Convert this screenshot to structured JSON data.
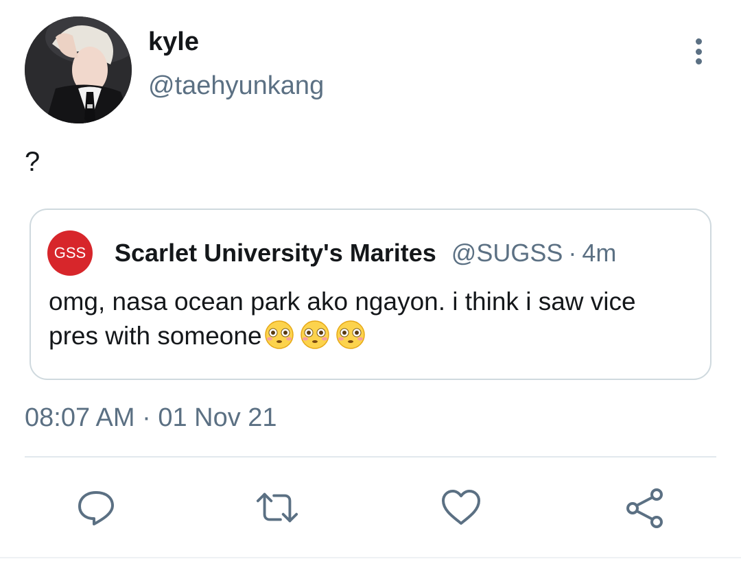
{
  "tweet": {
    "author": {
      "display_name": "kyle",
      "handle": "@taehyunkang"
    },
    "text": "?",
    "timestamp": "08:07 AM · 01 Nov 21",
    "quoted": {
      "avatar_text": "GSS",
      "display_name": "Scarlet University's Marites",
      "handle": "@SUGSS",
      "separator": "·",
      "time": "4m",
      "text": "omg, nasa ocean park ako ngayon. i think i saw vice pres with someone",
      "emojis": [
        "flushed-face",
        "flushed-face",
        "flushed-face"
      ]
    }
  },
  "actions": [
    {
      "name": "reply",
      "icon": "speech-bubble-icon"
    },
    {
      "name": "retweet",
      "icon": "retweet-arrows-icon"
    },
    {
      "name": "like",
      "icon": "heart-outline-icon"
    },
    {
      "name": "share",
      "icon": "share-nodes-icon"
    }
  ],
  "colors": {
    "text_primary": "#14171a",
    "text_secondary": "#5b7083",
    "border": "#cfd9de",
    "quote_avatar_bg": "#d7262b"
  }
}
